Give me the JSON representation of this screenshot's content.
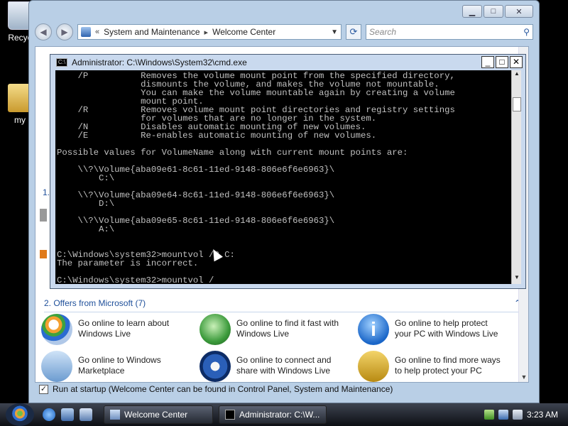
{
  "desktop": {
    "recycle_label": "Recyc",
    "folder_label": "my"
  },
  "welcome_window": {
    "address": {
      "sep": "«",
      "crumb1": "System and Maintenance",
      "crumb2": "Welcome Center"
    },
    "search_placeholder": "Search",
    "side_label": "1.",
    "offers_title": "2. Offers from Microsoft (7)",
    "offers": [
      {
        "line1": "Go online to learn about",
        "line2": "Windows Live",
        "icon": "windows-flag-icon"
      },
      {
        "line1": "Go online to find it fast with",
        "line2": "Windows Live",
        "icon": "globe-search-icon"
      },
      {
        "line1": "Go online to help protect",
        "line2": "your PC with Windows Live",
        "icon": "info-icon"
      },
      {
        "line1": "Go online to Windows",
        "line2": "Marketplace",
        "icon": "shopping-bag-icon"
      },
      {
        "line1": "Go online to connect and",
        "line2": "share with Windows Live",
        "icon": "windows-orb-icon"
      },
      {
        "line1": "Go online to find more ways",
        "line2": "to help protect your PC",
        "icon": "padlock-icon"
      }
    ],
    "startup_label": "Run at startup (Welcome Center can be found in Control Panel, System and Maintenance)",
    "startup_checked": true
  },
  "cmd_window": {
    "title": "Administrator: C:\\Windows\\System32\\cmd.exe",
    "icon_text": "C:\\",
    "lines": [
      "    /P          Removes the volume mount point from the specified directory,",
      "                dismounts the volume, and makes the volume not mountable.",
      "                You can make the volume mountable again by creating a volume",
      "                mount point.",
      "    /R          Removes volume mount point directories and registry settings",
      "                for volumes that are no longer in the system.",
      "    /N          Disables automatic mounting of new volumes.",
      "    /E          Re-enables automatic mounting of new volumes.",
      "",
      "Possible values for VolumeName along with current mount points are:",
      "",
      "    \\\\?\\Volume{aba09e61-8c61-11ed-9148-806e6f6e6963}\\",
      "        C:\\",
      "",
      "    \\\\?\\Volume{aba09e64-8c61-11ed-9148-806e6f6e6963}\\",
      "        D:\\",
      "",
      "    \\\\?\\Volume{aba09e65-8c61-11ed-9148-806e6f6e6963}\\",
      "        A:\\",
      "",
      "",
      "C:\\Windows\\system32>mountvol /P C:",
      "The parameter is incorrect.",
      "",
      "C:\\Windows\\system32>mountvol /"
    ]
  },
  "taskbar": {
    "tasks": [
      {
        "label": "Welcome Center"
      },
      {
        "label": "Administrator: C:\\W..."
      }
    ],
    "clock": "3:23 AM"
  }
}
